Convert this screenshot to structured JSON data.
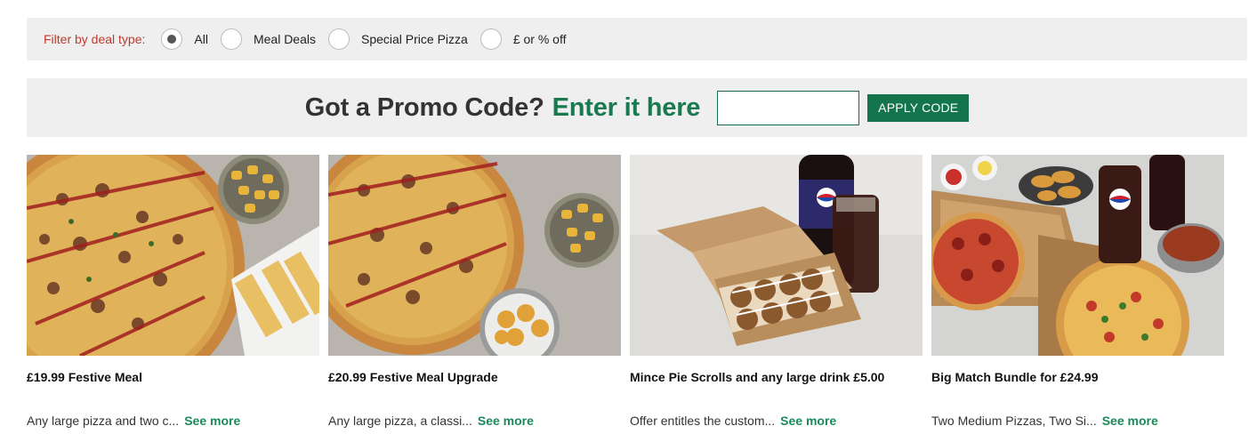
{
  "filter": {
    "label": "Filter by deal type:",
    "options": [
      {
        "label": "All",
        "selected": true
      },
      {
        "label": "Meal Deals",
        "selected": false
      },
      {
        "label": "Special Price Pizza",
        "selected": false
      },
      {
        "label": "£ or % off",
        "selected": false
      }
    ]
  },
  "promo": {
    "question": "Got a Promo Code?",
    "enter": "Enter it here",
    "input_value": "",
    "button": "APPLY CODE"
  },
  "cards": [
    {
      "title": "£19.99 Festive Meal",
      "desc": "Any large pizza and two c...",
      "see_more": "See more"
    },
    {
      "title": "£20.99 Festive Meal Upgrade",
      "desc": "Any large pizza, a classi...",
      "see_more": "See more"
    },
    {
      "title": "Mince Pie Scrolls and any large drink £5.00",
      "desc": "Offer entitles the custom...",
      "see_more": "See more"
    },
    {
      "title": "Big Match Bundle for £24.99",
      "desc": "Two Medium Pizzas, Two Si...",
      "see_more": "See more"
    }
  ],
  "colors": {
    "accent": "#1a7a4f",
    "filter_label": "#c0392b",
    "panel_bg": "#efefef"
  }
}
